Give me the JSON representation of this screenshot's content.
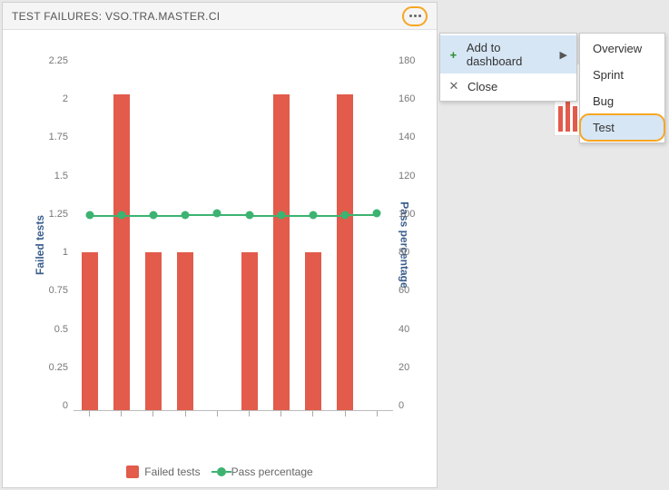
{
  "panel": {
    "title": "TEST FAILURES: VSO.TRA.MASTER.CI"
  },
  "menu": {
    "add_to_dashboard": "Add to dashboard",
    "close": "Close"
  },
  "submenu": {
    "overview": "Overview",
    "sprint": "Sprint",
    "bug": "Bug",
    "test": "Test"
  },
  "legend": {
    "failed": "Failed tests",
    "pass": "Pass percentage"
  },
  "axis": {
    "left_label": "Failed tests",
    "right_label": "Pass percentage",
    "left_ticks": [
      "2.25",
      "2",
      "1.75",
      "1.5",
      "1.25",
      "1",
      "0.75",
      "0.5",
      "0.25",
      "0"
    ],
    "right_ticks": [
      "180",
      "160",
      "140",
      "120",
      "100",
      "80",
      "60",
      "40",
      "20",
      "0"
    ]
  },
  "chart_data": {
    "type": "bar-line-dual-axis",
    "series": [
      {
        "name": "Failed tests",
        "axis": "left",
        "type": "bar",
        "values": [
          1,
          2,
          1,
          1,
          0,
          1,
          2,
          1,
          2,
          0
        ]
      },
      {
        "name": "Pass percentage",
        "axis": "right",
        "type": "line",
        "values": [
          99,
          99,
          99,
          99,
          100,
          99,
          99,
          99,
          99,
          100
        ]
      }
    ],
    "y_left": {
      "label": "Failed tests",
      "min": 0,
      "max": 2.25,
      "step": 0.25
    },
    "y_right": {
      "label": "Pass percentage",
      "min": 0,
      "max": 180,
      "step": 20
    },
    "n_points": 10
  }
}
